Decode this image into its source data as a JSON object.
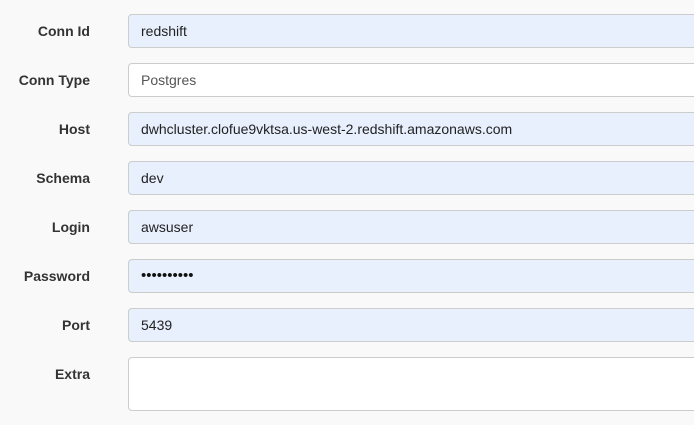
{
  "form": {
    "conn_id": {
      "label": "Conn Id",
      "value": "redshift"
    },
    "conn_type": {
      "label": "Conn Type",
      "value": "Postgres"
    },
    "host": {
      "label": "Host",
      "value": "dwhcluster.clofue9vktsa.us-west-2.redshift.amazonaws.com"
    },
    "schema": {
      "label": "Schema",
      "value": "dev"
    },
    "login": {
      "label": "Login",
      "value": "awsuser"
    },
    "password": {
      "label": "Password",
      "value": "••••••••••"
    },
    "port": {
      "label": "Port",
      "value": "5439"
    },
    "extra": {
      "label": "Extra",
      "value": ""
    }
  },
  "colors": {
    "autofill_background": "#e8f0fe",
    "page_background": "#f9f9f9",
    "border": "#cccccc",
    "label_text": "#333333"
  }
}
